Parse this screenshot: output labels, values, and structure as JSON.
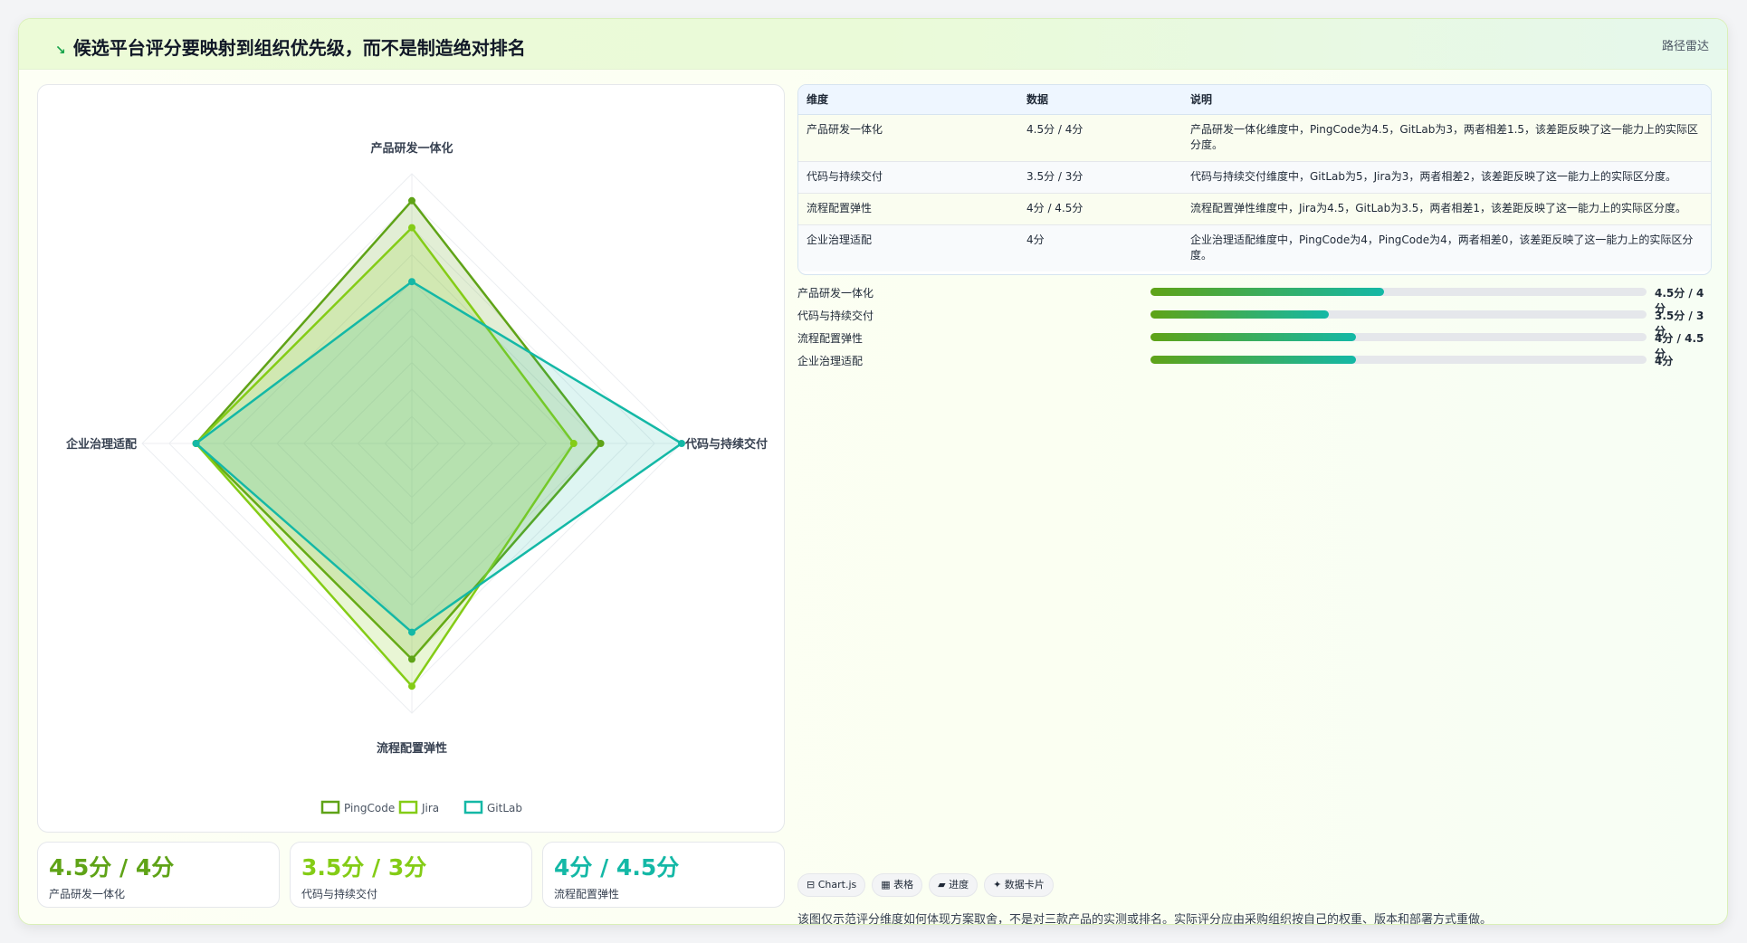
{
  "header": {
    "icon": "↘",
    "title": "候选平台评分要映射到组织优先级，而不是制造绝对排名",
    "route": "路径雷达"
  },
  "chart_data": {
    "type": "radar",
    "axes": [
      "产品研发一体化",
      "代码与持续交付",
      "流程配置弹性",
      "企业治理适配"
    ],
    "max": 5,
    "series": [
      {
        "name": "PingCode",
        "values": [
          4.5,
          3.5,
          4,
          4
        ],
        "color": "#5fa317"
      },
      {
        "name": "Jira",
        "values": [
          4,
          3,
          4.5,
          4
        ],
        "color": "#84cc16"
      },
      {
        "name": "GitLab",
        "values": [
          3,
          5,
          3.5,
          4
        ],
        "color": "#14b8a6"
      }
    ],
    "legend": "bottom"
  },
  "table": {
    "headers": [
      "维度",
      "数据",
      "说明"
    ],
    "rows": [
      {
        "dim": "产品研发一体化",
        "data": "4.5分 / 4分",
        "desc": "产品研发一体化维度中，PingCode为4.5，GitLab为3，两者相差1.5，该差距反映了这一能力上的实际区分度。"
      },
      {
        "dim": "代码与持续交付",
        "data": "3.5分 / 3分",
        "desc": "代码与持续交付维度中，GitLab为5，Jira为3，两者相差2，该差距反映了这一能力上的实际区分度。"
      },
      {
        "dim": "流程配置弹性",
        "data": "4分 / 4.5分",
        "desc": "流程配置弹性维度中，Jira为4.5，GitLab为3.5，两者相差1，该差距反映了这一能力上的实际区分度。"
      },
      {
        "dim": "企业治理适配",
        "data": "4分",
        "desc": "企业治理适配维度中，PingCode为4，PingCode为4，两者相差0，该差距反映了这一能力上的实际区分度。"
      }
    ]
  },
  "progress": [
    {
      "label": "产品研发一体化",
      "value": "4.5分 / 4分",
      "fraction": 0.47
    },
    {
      "label": "代码与持续交付",
      "value": "3.5分 / 3分",
      "fraction": 0.36
    },
    {
      "label": "流程配置弹性",
      "value": "4分 / 4.5分",
      "fraction": 0.415
    },
    {
      "label": "企业治理适配",
      "value": "4分",
      "fraction": 0.415
    }
  ],
  "kpis": [
    {
      "value": "4.5分 / 4分",
      "label": "产品研发一体化",
      "color": "#5fa317"
    },
    {
      "value": "3.5分 / 3分",
      "label": "代码与持续交付",
      "color": "#84cc16"
    },
    {
      "value": "4分 / 4.5分",
      "label": "流程配置弹性",
      "color": "#14b8a6"
    }
  ],
  "tags": [
    "⊟ Chart.js",
    "▦ 表格",
    "▰ 进度",
    "✦ 数据卡片"
  ],
  "note": "该图仅示范评分维度如何体现方案取舍，不是对三款产品的实测或排名。实际评分应由采购组织按自己的权重、版本和部署方式重做。"
}
